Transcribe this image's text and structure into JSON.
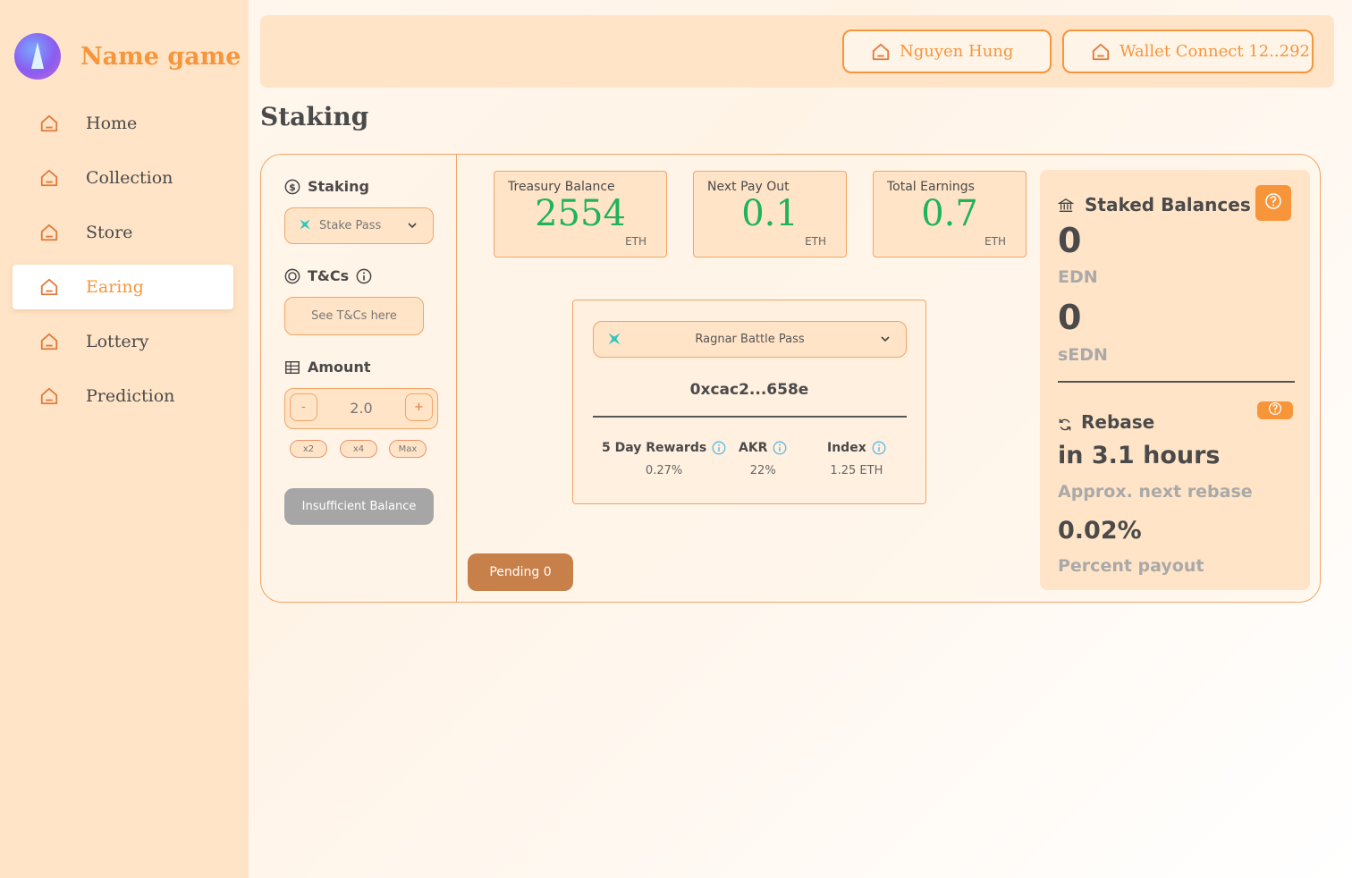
{
  "brand": {
    "name": "Name game"
  },
  "nav": {
    "items": [
      {
        "label": "Home"
      },
      {
        "label": "Collection"
      },
      {
        "label": "Store"
      },
      {
        "label": "Earing",
        "active": true
      },
      {
        "label": "Lottery"
      },
      {
        "label": "Prediction"
      }
    ]
  },
  "topbar": {
    "user_label": "Nguyen Hung",
    "wallet_label": "Wallet Connect 12..292"
  },
  "page": {
    "title": "Staking"
  },
  "staking_form": {
    "staking_heading": "Staking",
    "stake_select_value": "Stake Pass",
    "tcs_heading": "T&Cs",
    "tcs_button": "See T&Cs here",
    "amount_heading": "Amount",
    "amount_value": "2.0",
    "minus_label": "-",
    "plus_label": "+",
    "multipliers": [
      "x2",
      "x4",
      "Max"
    ],
    "submit_label": "Insufficient Balance"
  },
  "stats": [
    {
      "title": "Treasury Balance",
      "value": "2554",
      "unit": "ETH"
    },
    {
      "title": "Next Pay Out",
      "value": "0.1",
      "unit": "ETH"
    },
    {
      "title": "Total Earnings",
      "value": "0.7",
      "unit": "ETH"
    }
  ],
  "pass_panel": {
    "select_value": "Ragnar Battle Pass",
    "address": "0xcac2...658e",
    "metrics": [
      {
        "label": "5 Day Rewards",
        "value": "0.27%"
      },
      {
        "label": "AKR",
        "value": "22%"
      },
      {
        "label": "Index",
        "value": "1.25 ETH"
      }
    ]
  },
  "pending": {
    "label": "Pending 0"
  },
  "staked": {
    "heading": "Staked Balances",
    "edn_value": "0",
    "edn_label": "EDN",
    "sedn_value": "0",
    "sedn_label": "sEDN"
  },
  "rebase": {
    "heading": "Rebase",
    "time": "in 3.1 hours",
    "time_label": "Approx. next rebase",
    "percent": "0.02%",
    "percent_label": "Percent payout"
  },
  "colors": {
    "accent": "#f7953b",
    "sidebar_bg": "#ffe4c7",
    "value_green": "#1fb35a",
    "pending_bg": "#c8804a",
    "disabled_bg": "#a6a6a6"
  },
  "icons": [
    "home-icon",
    "dollar-circle-icon",
    "target-icon",
    "info-icon",
    "table-icon",
    "chevron-down-icon",
    "star-icon",
    "bank-icon",
    "help-icon",
    "refresh-icon"
  ]
}
